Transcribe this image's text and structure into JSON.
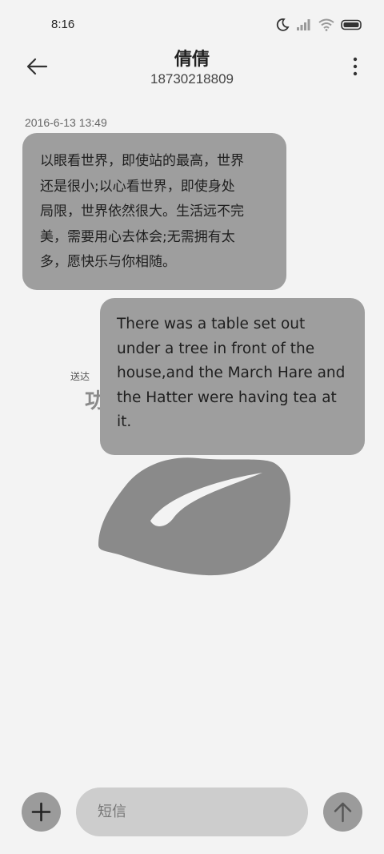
{
  "status_bar": {
    "time": "8:16",
    "icons": [
      "moon-icon",
      "signal-icon",
      "wifi-icon",
      "battery-icon"
    ]
  },
  "header": {
    "contact_name": "倩倩",
    "contact_number": "18730218809",
    "back_icon": "back-arrow-icon",
    "menu_icon": "more-vertical-icon"
  },
  "conversation": {
    "timestamp": "2016-6-13 13:49",
    "incoming_message": {
      "lines": [
        "以眼看世界，即使站的最高，世界",
        "还是很小;以心看世界，即使身处",
        "局限，世界依然很大。生活远不完",
        "美，需要用心去体会;无需拥有太",
        "多，愿快乐与你相随。"
      ]
    },
    "delivery_status": {
      "small_text": "送达",
      "large_text": "功"
    },
    "outgoing_message": {
      "lines": [
        "There was a table set out",
        "under a tree in front of the",
        "house,and the March Hare and",
        "the Hatter were having tea at",
        "it."
      ]
    }
  },
  "composer": {
    "placeholder": "短信",
    "add_icon": "plus-icon",
    "send_icon": "arrow-up-icon"
  },
  "colors": {
    "background": "#f3f3f3",
    "bubble": "#9e9e9e",
    "input": "#cdcdcd",
    "button": "#9b9b9b",
    "sticker": "#8a8a8a"
  }
}
